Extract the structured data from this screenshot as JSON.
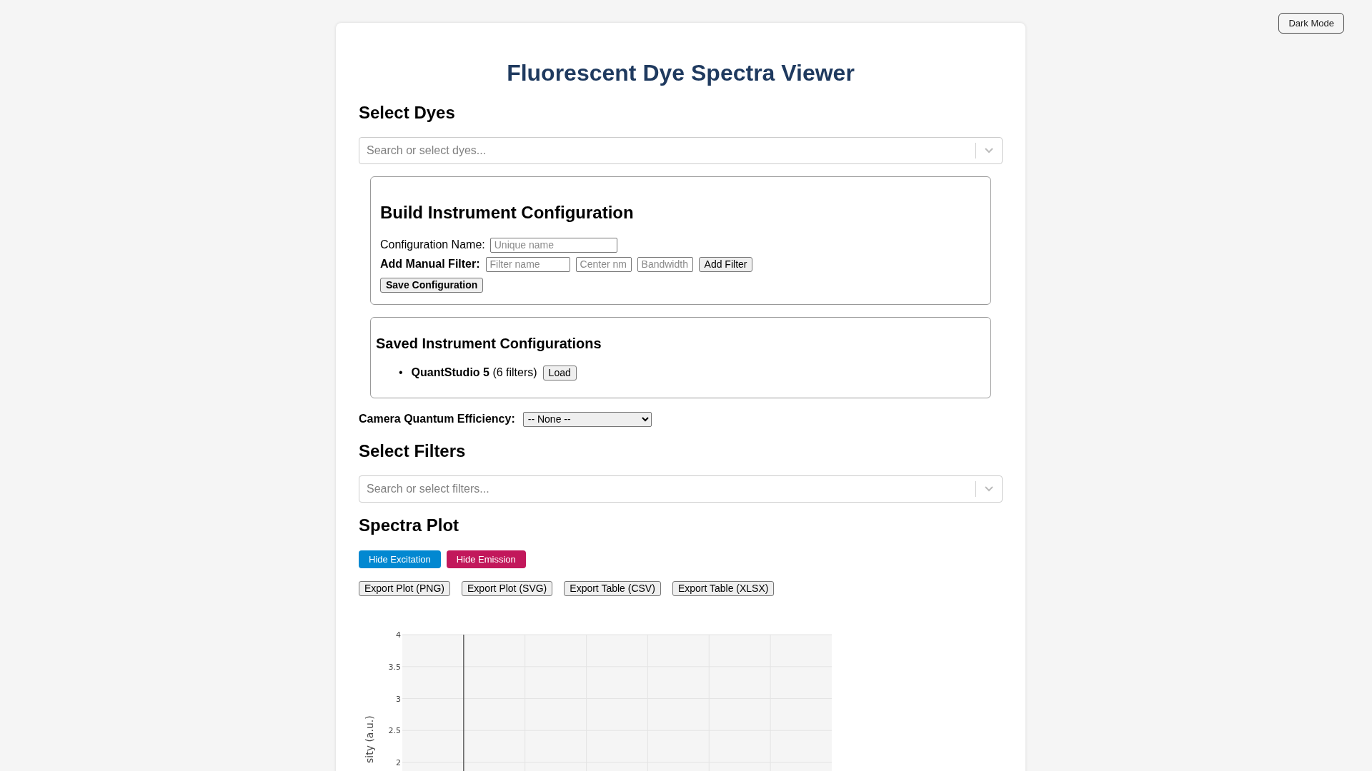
{
  "dark_mode_button": "Dark Mode",
  "title": "Fluorescent Dye Spectra Viewer",
  "dyes": {
    "heading": "Select Dyes",
    "placeholder": "Search or select dyes..."
  },
  "build_config": {
    "heading": "Build Instrument Configuration",
    "name_label": "Configuration Name:",
    "name_placeholder": "Unique name",
    "manual_filter_label": "Add Manual Filter:",
    "filter_fields": [
      {
        "placeholder": "Filter name"
      },
      {
        "placeholder": "Center nm"
      },
      {
        "placeholder": "Bandwidth"
      }
    ],
    "add_button": "Add Filter",
    "save_button": "Save Configuration"
  },
  "saved_configs": {
    "heading": "Saved Instrument Configurations",
    "items": [
      {
        "marker": "•",
        "text": "**QuantStudio 5** (6 filters)",
        "button": "Load"
      }
    ]
  },
  "camera_qe": {
    "label": "Camera Quantum Efficiency:",
    "value": "-- None --"
  },
  "filters": {
    "heading": "Select Filters",
    "placeholder": "Search or select filters..."
  },
  "plot": {
    "heading": "Spectra Plot",
    "toggle_buttons": [
      {
        "label": "Hide Excitation",
        "color": "#0288d1"
      },
      {
        "label": "Hide Emission",
        "color": "#c2185b"
      }
    ],
    "export_buttons": [
      "Export Plot (PNG)",
      "Export Plot (SVG)",
      "Export Table (CSV)",
      "Export Table (XLSX)"
    ],
    "axis_title": "sity (a.u.)",
    "axis_ticks": [
      "4",
      "3.5",
      "3",
      "2.5",
      "2"
    ]
  }
}
